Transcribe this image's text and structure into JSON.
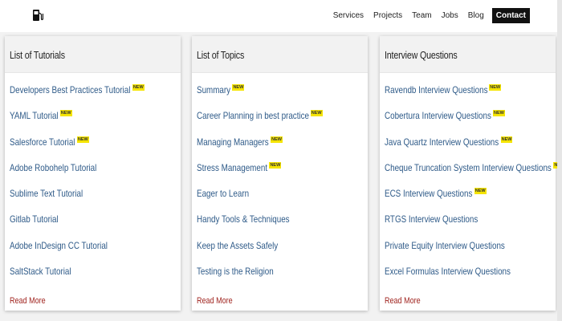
{
  "nav": {
    "logo_icon": "fuel-pump-icon",
    "items": [
      "Services",
      "Projects",
      "Team",
      "Jobs",
      "Blog"
    ],
    "contact": "Contact"
  },
  "badge_text": "NEW",
  "colors": {
    "link": "#2e5a88",
    "read_more": "#a0241f",
    "badge": "#f5e400"
  },
  "cards": [
    {
      "title": "List of Tutorials",
      "items": [
        {
          "text": "Developers Best Practices Tutorial",
          "badge": "NEW"
        },
        {
          "text": "YAML Tutorial",
          "badge": "NEW"
        },
        {
          "text": "Salesforce Tutorial",
          "badge": "NEW"
        },
        {
          "text": "Adobe Robohelp Tutorial",
          "badge": ""
        },
        {
          "text": "Sublime Text Tutorial",
          "badge": ""
        },
        {
          "text": "Gitlab Tutorial",
          "badge": ""
        },
        {
          "text": "Adobe InDesign CC Tutorial",
          "badge": ""
        },
        {
          "text": "SaltStack Tutorial",
          "badge": ""
        }
      ],
      "read_more": "Read More"
    },
    {
      "title": "List of Topics",
      "items": [
        {
          "text": "Summary",
          "badge": "NEW"
        },
        {
          "text": "Career Planning in best practice",
          "badge": "NEW"
        },
        {
          "text": "Managing Managers",
          "badge": "NEW"
        },
        {
          "text": "Stress Management",
          "badge": "NEW"
        },
        {
          "text": "Eager to Learn",
          "badge": ""
        },
        {
          "text": "Handy Tools & Techniques",
          "badge": ""
        },
        {
          "text": "Keep the Assets Safely",
          "badge": ""
        },
        {
          "text": "Testing is the Religion",
          "badge": ""
        }
      ],
      "read_more": "Read More"
    },
    {
      "title": "Interview Questions",
      "items": [
        {
          "text": "Ravendb Interview Questions",
          "badge": "NEW"
        },
        {
          "text": "Cobertura Interview Questions",
          "badge": "NEW"
        },
        {
          "text": "Java Quartz Interview Questions",
          "badge": "NEW"
        },
        {
          "text": "Cheque Truncation System Interview Questions",
          "badge": "NEW"
        },
        {
          "text": "ECS Interview Questions",
          "badge": "NEW"
        },
        {
          "text": "RTGS Interview Questions",
          "badge": ""
        },
        {
          "text": "Private Equity Interview Questions",
          "badge": ""
        },
        {
          "text": "Excel Formulas Interview Questions",
          "badge": ""
        }
      ],
      "read_more": "Read More"
    }
  ]
}
